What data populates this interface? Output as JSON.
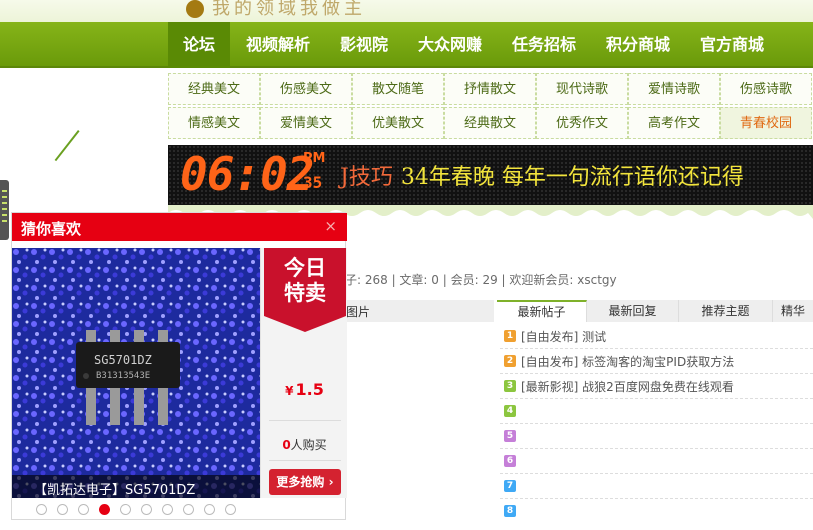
{
  "site": {
    "logo_text": "我的领域我做主"
  },
  "nav": {
    "items": [
      {
        "label": "论坛",
        "active": true
      },
      {
        "label": "视频解析"
      },
      {
        "label": "影视院"
      },
      {
        "label": "大众网赚"
      },
      {
        "label": "任务招标"
      },
      {
        "label": "积分商城"
      },
      {
        "label": "官方商城"
      }
    ]
  },
  "subnav": {
    "row1": [
      "经典美文",
      "伤感美文",
      "散文随笔",
      "抒情散文",
      "现代诗歌",
      "爱情诗歌",
      "伤感诗歌"
    ],
    "row2": [
      "情感美文",
      "爱情美文",
      "优美散文",
      "经典散文",
      "优秀作文",
      "高考作文",
      "青春校园"
    ],
    "active_row2_index": 6
  },
  "ticker": {
    "time": "06:02",
    "ampm": "PM",
    "seconds": "35",
    "prefix": "J技巧",
    "headline": "34年春晚  每年一句流行语你还记得"
  },
  "stats": {
    "text": "子: 268 | 文章: 0 | 会员: 29 | 欢迎新会员: xsctgy"
  },
  "tabs": {
    "left_label": "图片",
    "items": [
      {
        "label": "最新帖子",
        "active": true
      },
      {
        "label": "最新回复"
      },
      {
        "label": "推荐主题"
      },
      {
        "label": "精华"
      }
    ]
  },
  "posts": [
    {
      "num": "1",
      "color": "#f0a030",
      "title": "[自由发布] 测试"
    },
    {
      "num": "2",
      "color": "#f0a030",
      "title": "[自由发布] 标签淘客的淘宝PID获取方法"
    },
    {
      "num": "3",
      "color": "#8cc63f",
      "title": "[最新影视] 战狼2百度网盘免费在线观看"
    },
    {
      "num": "4",
      "color": "#8cc63f",
      "title": ""
    },
    {
      "num": "5",
      "color": "#c57fd8",
      "title": ""
    },
    {
      "num": "6",
      "color": "#c57fd8",
      "title": ""
    },
    {
      "num": "7",
      "color": "#3fa9f5",
      "title": ""
    },
    {
      "num": "8",
      "color": "#3fa9f5",
      "title": ""
    }
  ],
  "widget": {
    "title": "猜你喜欢",
    "close": "×",
    "deal": "今日\n特卖",
    "currency": "¥",
    "price": "1.5",
    "buyers_count": "0",
    "buyers_suffix": "人购买",
    "buy_label": "更多抢购",
    "caption": "【凯拓达电子】SG5701DZ",
    "chip_label_1": "SG5701DZ",
    "chip_label_2": "B31313543E",
    "dots_total": 10,
    "dots_active_index": 3
  },
  "colors": {
    "brand_green": "#7aab14",
    "accent_red": "#e60012",
    "ticker_orange": "#ff6418",
    "ticker_yellow": "#f2e43c"
  }
}
